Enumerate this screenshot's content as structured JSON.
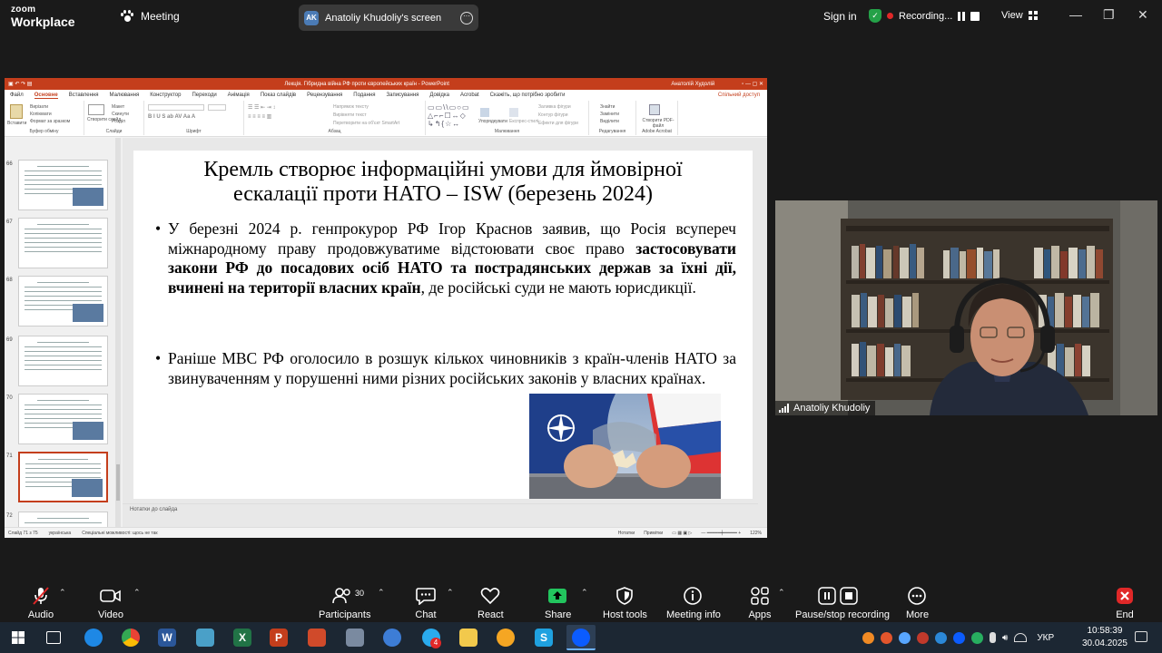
{
  "zoom": {
    "logo_top": "zoom",
    "logo_bottom": "Workplace",
    "meeting_label": "Meeting",
    "share_initials": "AK",
    "share_label": "Anatoliy Khudoliy's screen",
    "signin_label": "Sign in",
    "recording_label": "Recording...",
    "view_label": "View",
    "accent_color": "#0b5cff",
    "record_color": "#e02828"
  },
  "ppt": {
    "window_title": "Лекція. Гібридна війна РФ проти європейських країн  -  PowerPoint",
    "user": "Анатолій Худолій",
    "tabs": [
      "Файл",
      "Основне",
      "Вставлення",
      "Малювання",
      "Конструктор",
      "Переходи",
      "Анімація",
      "Показ слайдів",
      "Рецензування",
      "Подання",
      "Записування",
      "Довідка",
      "Acrobat",
      "Скажіть, що потрібно зробити"
    ],
    "active_tab": "Основне",
    "share_tab": "Спільний доступ",
    "ribbon": {
      "clipboard_label": "Буфер обміну",
      "cut": "Вирізати",
      "copy": "Копіювати",
      "format": "Формат за зразком",
      "paste": "Вставити",
      "new_slide": "Створити слайд",
      "layout": "Макет",
      "reset": "Скинути",
      "section": "Розділ",
      "slides_label": "Слайди",
      "font_label": "Шрифт",
      "paragraph_label": "Абзац",
      "text_dir": "Напрямок тексту",
      "align_text": "Вирівняти текст",
      "smartart": "Перетворити на об'єкт SmartArt",
      "drawing_label": "Малювання",
      "arrange": "Упорядкувати",
      "quick_styles": "Експрес-стилі",
      "fill": "Заливка фігури",
      "outline": "Контур фігури",
      "effects": "Ефекти для фігури",
      "find": "Знайти",
      "replace": "Замінити",
      "select": "Виділити",
      "editing_label": "Редагування",
      "create_pdf": "Створити PDF-файл",
      "acrobat_label": "Adobe Acrobat"
    },
    "thumb_numbers": [
      "66",
      "67",
      "68",
      "69",
      "70",
      "71",
      "72"
    ],
    "slide": {
      "title": "Кремль створює інформаційні умови для ймовірної ескалації проти НАТО – ISW (березень 2024)",
      "bullet_char": "•",
      "b1_plain": "У березні 2024 р. генпрокурор РФ Ігор Краснов заявив, що Росія всупереч міжнародному праву продовжуватиме відстоювати своє право ",
      "b1_bold": "застосовувати закони РФ до посадових осіб НАТО та пострадянських держав за їхні дії, вчинені на території власних країн",
      "b1_end": ", де російські суди не мають юрисдикції.",
      "b2": "Раніше МВС РФ оголосило в розшук кількох чиновників з країн-членів НАТО за звинуваченням у порушенні ними різних російських законів у власних країнах."
    },
    "notes": "Нотатки до слайда",
    "status_slide": "Слайд 71 з 75",
    "status_lang": "українська",
    "status_access": "Спеціальні можливості: щось не так",
    "status_notes": "Нотатки",
    "status_comments": "Примітки",
    "zoom_level": "122%"
  },
  "cam": {
    "name": "Anatoliy Khudoliy"
  },
  "toolbar": {
    "audio": "Audio",
    "video": "Video",
    "participants": "Participants",
    "participants_count": "30",
    "chat": "Chat",
    "react": "React",
    "share": "Share",
    "host_tools": "Host tools",
    "meeting_info": "Meeting info",
    "apps": "Apps",
    "pause_stop": "Pause/stop recording",
    "more": "More",
    "end": "End",
    "share_color": "#22c55e",
    "end_color": "#e02828"
  },
  "taskbar": {
    "badge": "4",
    "lang": "УКР",
    "time": "10:58:39",
    "date": "30.04.2025"
  }
}
